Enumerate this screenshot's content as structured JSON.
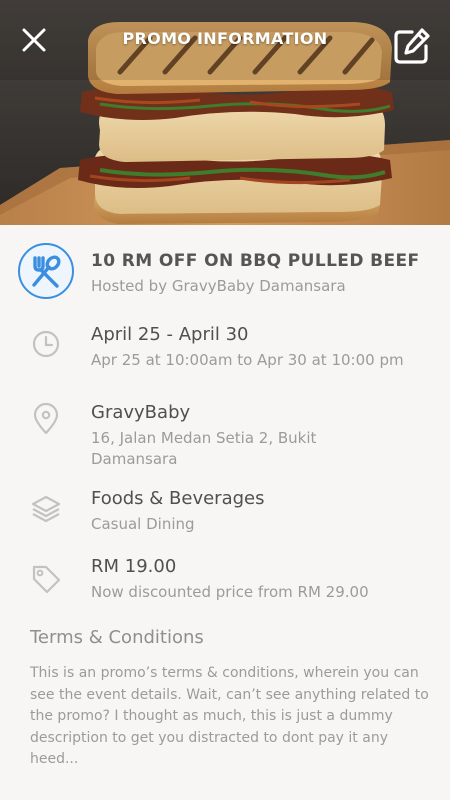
{
  "header": {
    "title": "PROMO INFORMATION",
    "close_icon": "close-icon",
    "edit_icon": "edit-icon"
  },
  "hero": {
    "image": "bbq-pulled-beef-sandwich-photo"
  },
  "promo": {
    "icon": "fork-spoon-icon",
    "title": "10 RM OFF ON BBQ PULLED BEEF",
    "host": "Hosted by GravyBaby Damansara"
  },
  "details": {
    "date": {
      "icon": "clock-icon",
      "range": "April 25 - April 30",
      "time": "Apr 25 at 10:00am to Apr 30 at 10:00 pm"
    },
    "location": {
      "icon": "location-pin-icon",
      "name": "GravyBaby",
      "address": "16, Jalan Medan Setia 2, Bukit Damansara"
    },
    "category": {
      "icon": "layers-icon",
      "name": "Foods & Beverages",
      "sub": "Casual Dining"
    },
    "price": {
      "icon": "price-tag-icon",
      "amount": "RM 19.00",
      "note": "Now discounted price from RM 29.00"
    }
  },
  "terms": {
    "title": "Terms & Conditions",
    "body": "This is an promo’s terms & conditions, wherein you can see the event details. Wait, can’t see anything related to the promo? I thought as much, this is just a dummy description to get you distracted to dont pay it any heed..."
  },
  "colors": {
    "accent": "#3b8fe0",
    "background": "#f7f6f4",
    "text_primary": "#505050",
    "text_secondary": "#9b9b9b"
  }
}
